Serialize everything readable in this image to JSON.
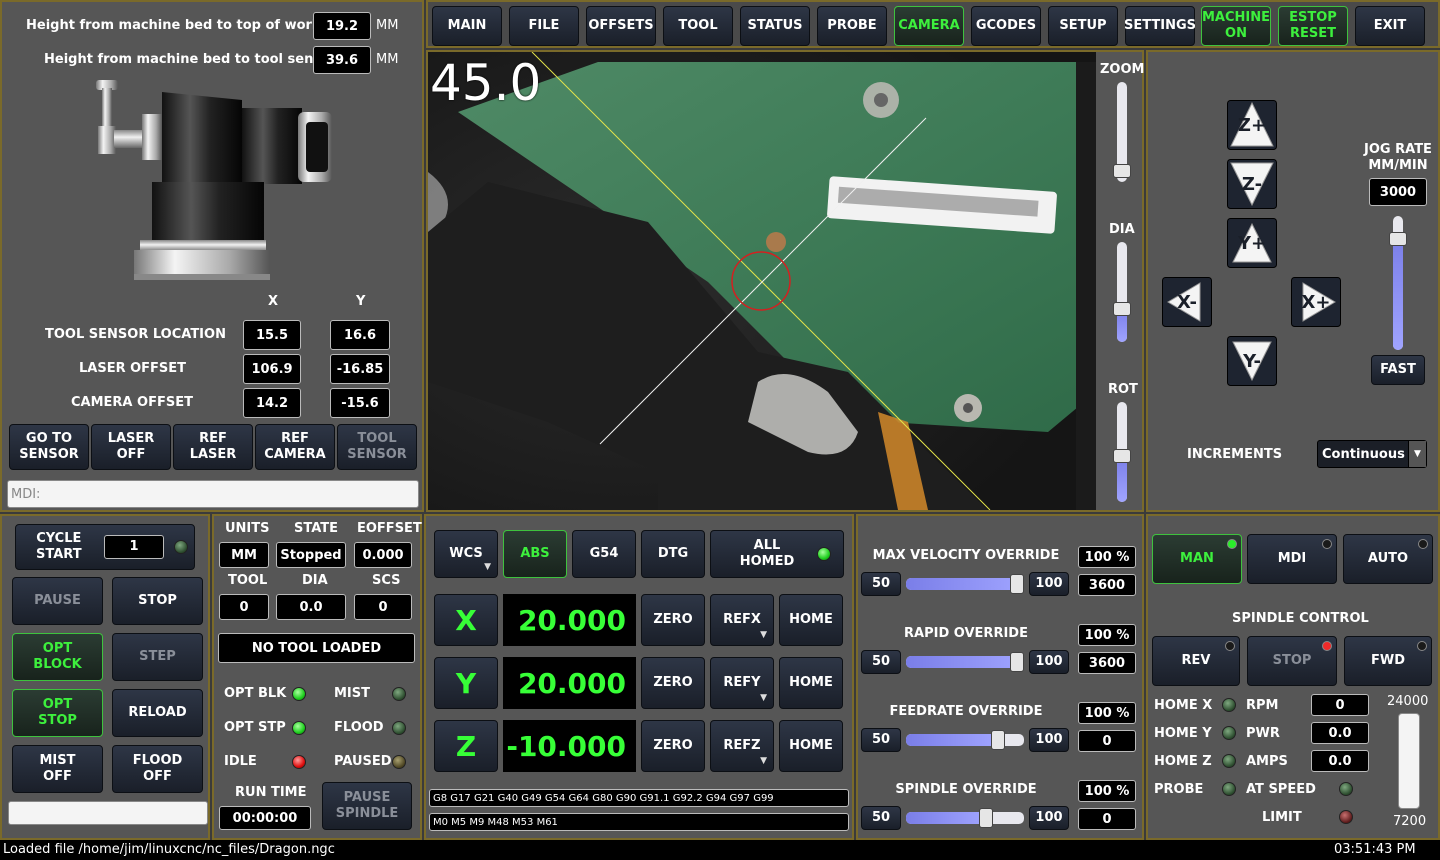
{
  "nav": {
    "tabs": [
      "MAIN",
      "FILE",
      "OFFSETS",
      "TOOL",
      "STATUS",
      "PROBE",
      "CAMERA",
      "GCODES",
      "SETUP",
      "SETTINGS"
    ],
    "active_tab": "CAMERA",
    "machine_on": [
      "MACHINE",
      "ON"
    ],
    "estop_reset": [
      "ESTOP",
      "RESET"
    ],
    "exit": "EXIT"
  },
  "tool_setup": {
    "workpiece_label": "Height from machine bed to top of workpiece",
    "workpiece_value": "19.2",
    "workpiece_unit": "MM",
    "sensor_label": "Height from machine bed to tool sensor",
    "sensor_value": "39.6",
    "sensor_unit": "MM",
    "col_x": "X",
    "col_y": "Y",
    "rows": [
      {
        "label": "TOOL SENSOR LOCATION",
        "x": "15.5",
        "y": "16.6"
      },
      {
        "label": "LASER OFFSET",
        "x": "106.9",
        "y": "-16.85"
      },
      {
        "label": "CAMERA OFFSET",
        "x": "14.2",
        "y": "-15.6"
      }
    ],
    "buttons": [
      [
        "GO TO",
        "SENSOR"
      ],
      [
        "LASER",
        "OFF"
      ],
      [
        "REF",
        "LASER"
      ],
      [
        "REF",
        "CAMERA"
      ],
      [
        "TOOL",
        "SENSOR"
      ]
    ],
    "mdi_placeholder": "MDI:"
  },
  "camera": {
    "angle": "45.0",
    "zoom_label": "ZOOM",
    "dia_label": "DIA",
    "rot_label": "ROT",
    "zoom_level": 0.05,
    "dia_level": 0.7,
    "rot_level": 0.55
  },
  "jog": {
    "buttons": [
      "Z+",
      "Z-",
      "Y+",
      "X-",
      "X+",
      "Y-"
    ],
    "rate_label": [
      "JOG RATE",
      "MM/MIN"
    ],
    "rate_value": "3000",
    "fast_label": "FAST",
    "increments_label": "INCREMENTS",
    "increments_value": "Continuous"
  },
  "cycle": {
    "cycle_start": [
      "CYCLE",
      "START"
    ],
    "cycle_count": "1",
    "pause": "PAUSE",
    "stop": "STOP",
    "opt_block": [
      "OPT",
      "BLOCK"
    ],
    "step": "STEP",
    "opt_stop": [
      "OPT",
      "STOP"
    ],
    "reload": "RELOAD",
    "mist_off": [
      "MIST",
      "OFF"
    ],
    "flood_off": [
      "FLOOD",
      "OFF"
    ]
  },
  "status": {
    "headers": [
      "UNITS",
      "STATE",
      "EOFFSET"
    ],
    "values": [
      "MM",
      "Stopped",
      "0.000"
    ],
    "headers2": [
      "TOOL",
      "DIA",
      "SCS"
    ],
    "values2": [
      "0",
      "0.0",
      "0"
    ],
    "tool_status": "NO TOOL LOADED",
    "indicators": [
      {
        "label": "OPT BLK",
        "state": "green"
      },
      {
        "label": "MIST",
        "state": "off"
      },
      {
        "label": "OPT STP",
        "state": "green"
      },
      {
        "label": "FLOOD",
        "state": "off"
      },
      {
        "label": "IDLE",
        "state": "red"
      },
      {
        "label": "PAUSED",
        "state": "offy"
      }
    ],
    "run_time_label": "RUN TIME",
    "run_time_value": "00:00:00",
    "pause_spindle": [
      "PAUSE",
      "SPINDLE"
    ]
  },
  "dro": {
    "wcs": "WCS",
    "abs": "ABS",
    "g54": "G54",
    "dtg": "DTG",
    "all_homed": [
      "ALL",
      "HOMED"
    ],
    "axes": [
      {
        "axis": "X",
        "value": "20.000",
        "zero": "ZERO",
        "ref": "REFX",
        "home": "HOME"
      },
      {
        "axis": "Y",
        "value": "20.000",
        "zero": "ZERO",
        "ref": "REFY",
        "home": "HOME"
      },
      {
        "axis": "Z",
        "value": "-10.000",
        "zero": "ZERO",
        "ref": "REFZ",
        "home": "HOME"
      }
    ],
    "gcodes": "G8 G17 G21 G40 G49 G54 G64 G80 G90 G91.1 G92.2 G94 G97 G99",
    "mcodes": "M0 M5 M9 M48 M53 M61"
  },
  "overrides": [
    {
      "title": "MAX VELOCITY OVERRIDE",
      "min": "50",
      "max": "100",
      "percent": "100 %",
      "value": "3600",
      "level": 1.0
    },
    {
      "title": "RAPID OVERRIDE",
      "min": "50",
      "max": "100",
      "percent": "100 %",
      "value": "3600",
      "level": 1.0
    },
    {
      "title": "FEEDRATE OVERRIDE",
      "min": "50",
      "max": "100",
      "percent": "100 %",
      "value": "0",
      "level": 0.78
    },
    {
      "title": "SPINDLE OVERRIDE",
      "min": "50",
      "max": "100",
      "percent": "100 %",
      "value": "0",
      "level": 0.68
    }
  ],
  "mode": {
    "man": "MAN",
    "mdi": "MDI",
    "auto": "AUTO",
    "spindle_control": "SPINDLE CONTROL",
    "rev": "REV",
    "stop": "STOP",
    "fwd": "FWD",
    "home_x": "HOME X",
    "home_y": "HOME Y",
    "home_z": "HOME Z",
    "probe": "PROBE",
    "rpm_label": "RPM",
    "rpm_value": "0",
    "pwr_label": "PWR",
    "pwr_value": "0.0",
    "amps_label": "AMPS",
    "amps_value": "0.0",
    "at_speed_label": "AT SPEED",
    "limit_label": "LIMIT",
    "spindle_max": "24000",
    "spindle_min": "7200"
  },
  "statusbar": {
    "message": "Loaded file /home/jim/linuxcnc/nc_files/Dragon.ngc",
    "time": "03:51:43 PM"
  },
  "colors": {
    "accent_green": "#37ff37",
    "panel_bg": "#565656",
    "panel_border": "#7a6a2a",
    "crosshair": "#e3e34a",
    "reticle": "#d42020"
  }
}
